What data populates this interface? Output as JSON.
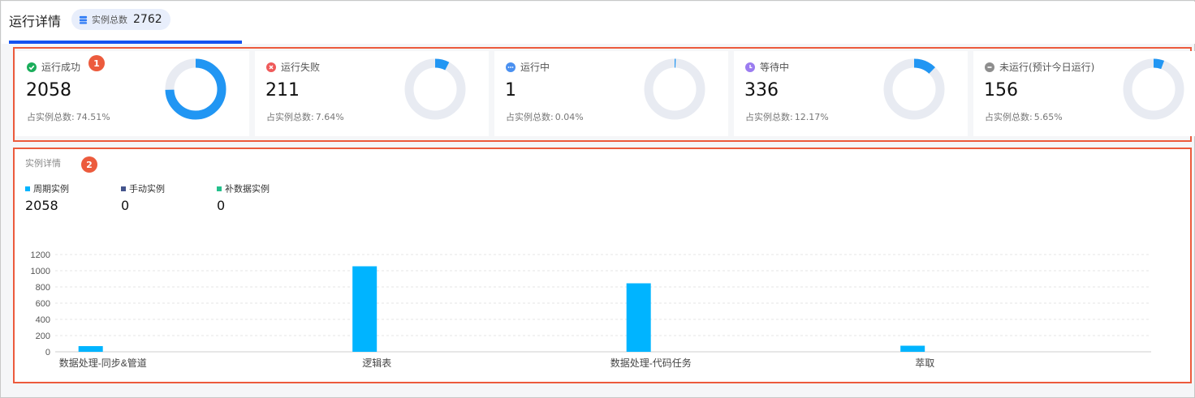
{
  "header": {
    "title": "运行详情",
    "total_label": "实例总数",
    "total_value": "2762"
  },
  "cards": [
    {
      "label": "运行成功",
      "count": "2058",
      "pct_label": "占实例总数:",
      "pct_value": "74.51%",
      "fraction": 0.7451,
      "status": "success",
      "color": "#1aad5a",
      "ring_color": "#2196f3",
      "icon": "check-circle-icon"
    },
    {
      "label": "运行失败",
      "count": "211",
      "pct_label": "占实例总数:",
      "pct_value": "7.64%",
      "fraction": 0.0764,
      "status": "failed",
      "color": "#ef5a5a",
      "ring_color": "#2196f3",
      "icon": "error-circle-icon"
    },
    {
      "label": "运行中",
      "count": "1",
      "pct_label": "占实例总数:",
      "pct_value": "0.04%",
      "fraction": 0.0004,
      "status": "running",
      "color": "#4a90f0",
      "ring_color": "#2196f3",
      "icon": "running-dots-icon"
    },
    {
      "label": "等待中",
      "count": "336",
      "pct_label": "占实例总数:",
      "pct_value": "12.17%",
      "fraction": 0.1217,
      "status": "waiting",
      "color": "#9b7cf0",
      "ring_color": "#2196f3",
      "icon": "clock-icon"
    },
    {
      "label": "未运行(预计今日运行)",
      "count": "156",
      "pct_label": "占实例总数:",
      "pct_value": "5.65%",
      "fraction": 0.0565,
      "status": "not-run",
      "color": "#8e8e8e",
      "ring_color": "#2196f3",
      "icon": "minus-circle-icon"
    }
  ],
  "annotations": {
    "stats_marker": "1",
    "detail_marker": "2"
  },
  "detail": {
    "title": "实例详情",
    "legend": [
      {
        "label": "周期实例",
        "value": "2058",
        "color": "#00b4ff"
      },
      {
        "label": "手动实例",
        "value": "0",
        "color": "#44548c"
      },
      {
        "label": "补数据实例",
        "value": "0",
        "color": "#24c08c"
      }
    ]
  },
  "chart_data": {
    "type": "bar",
    "categories": [
      "数据处理-同步&管道",
      "逻辑表",
      "数据处理-代码任务",
      "萃取"
    ],
    "series": [
      {
        "name": "周期实例",
        "values": [
          70,
          1055,
          845,
          75
        ],
        "color": "#00b4ff"
      },
      {
        "name": "手动实例",
        "values": [
          0,
          0,
          0,
          0
        ],
        "color": "#44548c"
      },
      {
        "name": "补数据实例",
        "values": [
          0,
          0,
          0,
          0
        ],
        "color": "#24c08c"
      }
    ],
    "yticks": [
      "0",
      "200",
      "400",
      "600",
      "800",
      "1000",
      "1200"
    ],
    "ylim": [
      0,
      1200
    ],
    "grid": true
  }
}
